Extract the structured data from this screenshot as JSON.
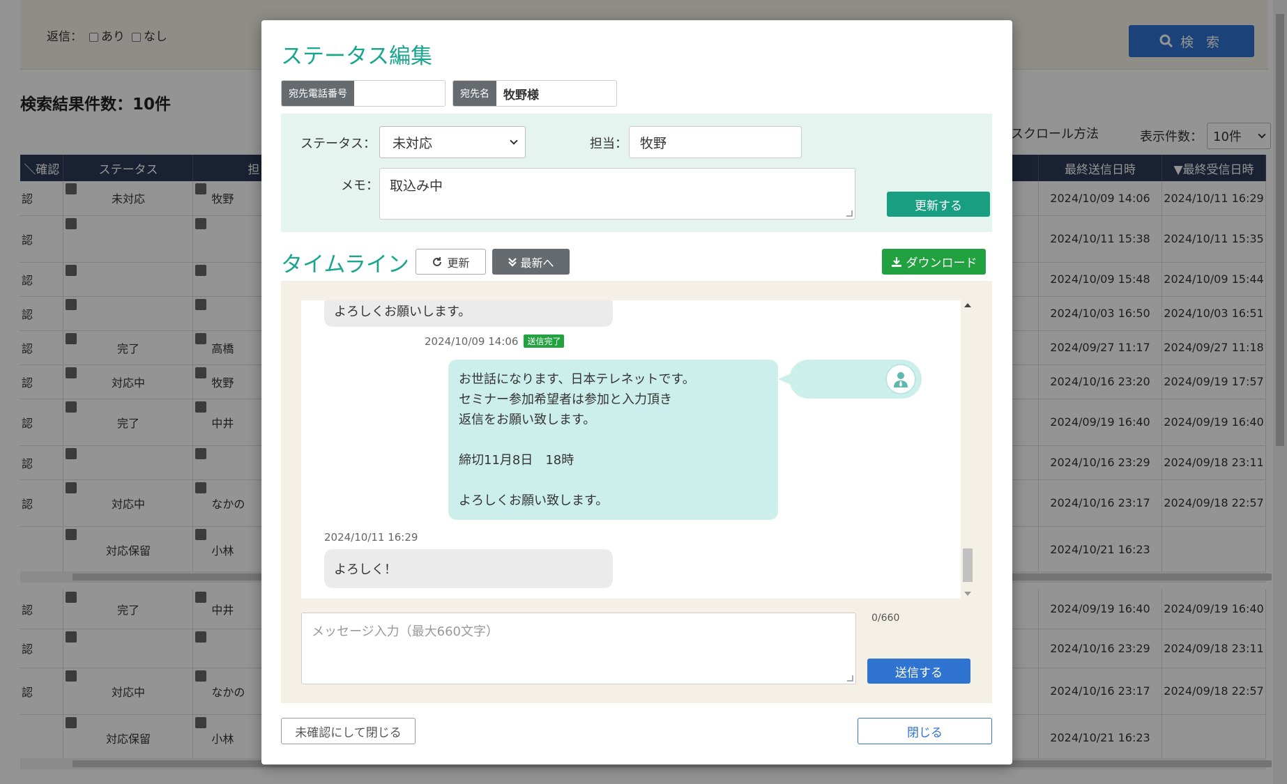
{
  "background": {
    "reply_label": "返信：",
    "reply_options": [
      "あり",
      "なし"
    ],
    "search_label": "検 索",
    "result_count": "検索結果件数：10件",
    "scroll_method": "スクロール方法",
    "display_count_label": "表示件数：",
    "display_count_value": "10件",
    "columns": [
      "＼確認",
      "ステータス",
      "担",
      "最終送信日時",
      "▼最終受信日時"
    ],
    "rows": [
      {
        "c": "認",
        "status": "未対応",
        "owner": "牧野",
        "sent": "2024/10/09 14:06",
        "recv": "2024/10/11 16:29"
      },
      {
        "c": "認",
        "status": "",
        "owner": "",
        "sent": "2024/10/11 15:38",
        "recv": "2024/10/11 15:35"
      },
      {
        "c": "認",
        "status": "",
        "owner": "",
        "sent": "2024/10/09 15:48",
        "recv": "2024/10/09 15:44"
      },
      {
        "c": "認",
        "status": "",
        "owner": "",
        "sent": "2024/10/03 16:50",
        "recv": "2024/10/03 16:51"
      },
      {
        "c": "認",
        "status": "完了",
        "owner": "高橋",
        "sent": "2024/09/27 11:17",
        "recv": "2024/09/27 11:18"
      },
      {
        "c": "認",
        "status": "対応中",
        "owner": "牧野",
        "sent": "2024/10/16 23:20",
        "recv": "2024/09/19 17:57"
      },
      {
        "c": "認",
        "status": "完了",
        "owner": "中井",
        "sent": "2024/09/19 16:40",
        "recv": "2024/09/19 16:40"
      },
      {
        "c": "認",
        "status": "",
        "owner": "",
        "sent": "2024/10/16 23:29",
        "recv": "2024/09/18 23:11"
      },
      {
        "c": "認",
        "status": "対応中",
        "owner": "なかの",
        "sent": "2024/10/16 23:17",
        "recv": "2024/09/18 22:57"
      },
      {
        "c": "",
        "status": "対応保留",
        "owner": "小林",
        "sent": "2024/10/21 16:23",
        "recv": ""
      }
    ],
    "rows2": [
      {
        "c": "認",
        "status": "完了",
        "owner": "中井",
        "sent": "2024/09/19 16:40",
        "recv": "2024/09/19 16:40"
      },
      {
        "c": "認",
        "status": "",
        "owner": "",
        "sent": "2024/10/16 23:29",
        "recv": "2024/09/18 23:11"
      },
      {
        "c": "認",
        "status": "対応中",
        "owner": "なかの",
        "sent": "2024/10/16 23:17",
        "recv": "2024/09/18 22:57"
      },
      {
        "c": "",
        "status": "対応保留",
        "owner": "小林",
        "sent": "2024/10/21 16:23",
        "recv": ""
      }
    ]
  },
  "modal": {
    "title": "ステータス編集",
    "phone_label": "宛先電話番号",
    "phone_value": "",
    "name_label": "宛先名",
    "name_value": "牧野様",
    "status_label": "ステータス：",
    "status_value": "未対応",
    "owner_label": "担当：",
    "owner_value": "牧野",
    "memo_label": "メモ：",
    "memo_value": "取込み中",
    "update_button": "更新する",
    "timeline_title": "タイムライン",
    "refresh_button": "更新",
    "latest_button": "最新へ",
    "download_button": "ダウンロード",
    "messages": {
      "first_in": "よろしくお願いします。",
      "out_time": "2024/10/09 14:06",
      "out_badge": "送信完了",
      "out_text": "お世話になります、日本テレネットです。\nセミナー参加希望者は参加と入力頂き\n返信をお願い致します。\n\n締切11月8日　18時\n\nよろしくお願い致します。",
      "in_time": "2024/10/11 16:29",
      "in_text": "よろしく！"
    },
    "message_placeholder": "メッセージ入力（最大660文字）",
    "char_count": "0/660",
    "send_button": "送信する",
    "unconfirm_close_button": "未確認にして閉じる",
    "close_button": "閉じる"
  },
  "colors": {
    "accent": "#1aa58f",
    "primary": "#2f74d0",
    "success": "#22a140",
    "bubble_out": "#ccefec"
  }
}
